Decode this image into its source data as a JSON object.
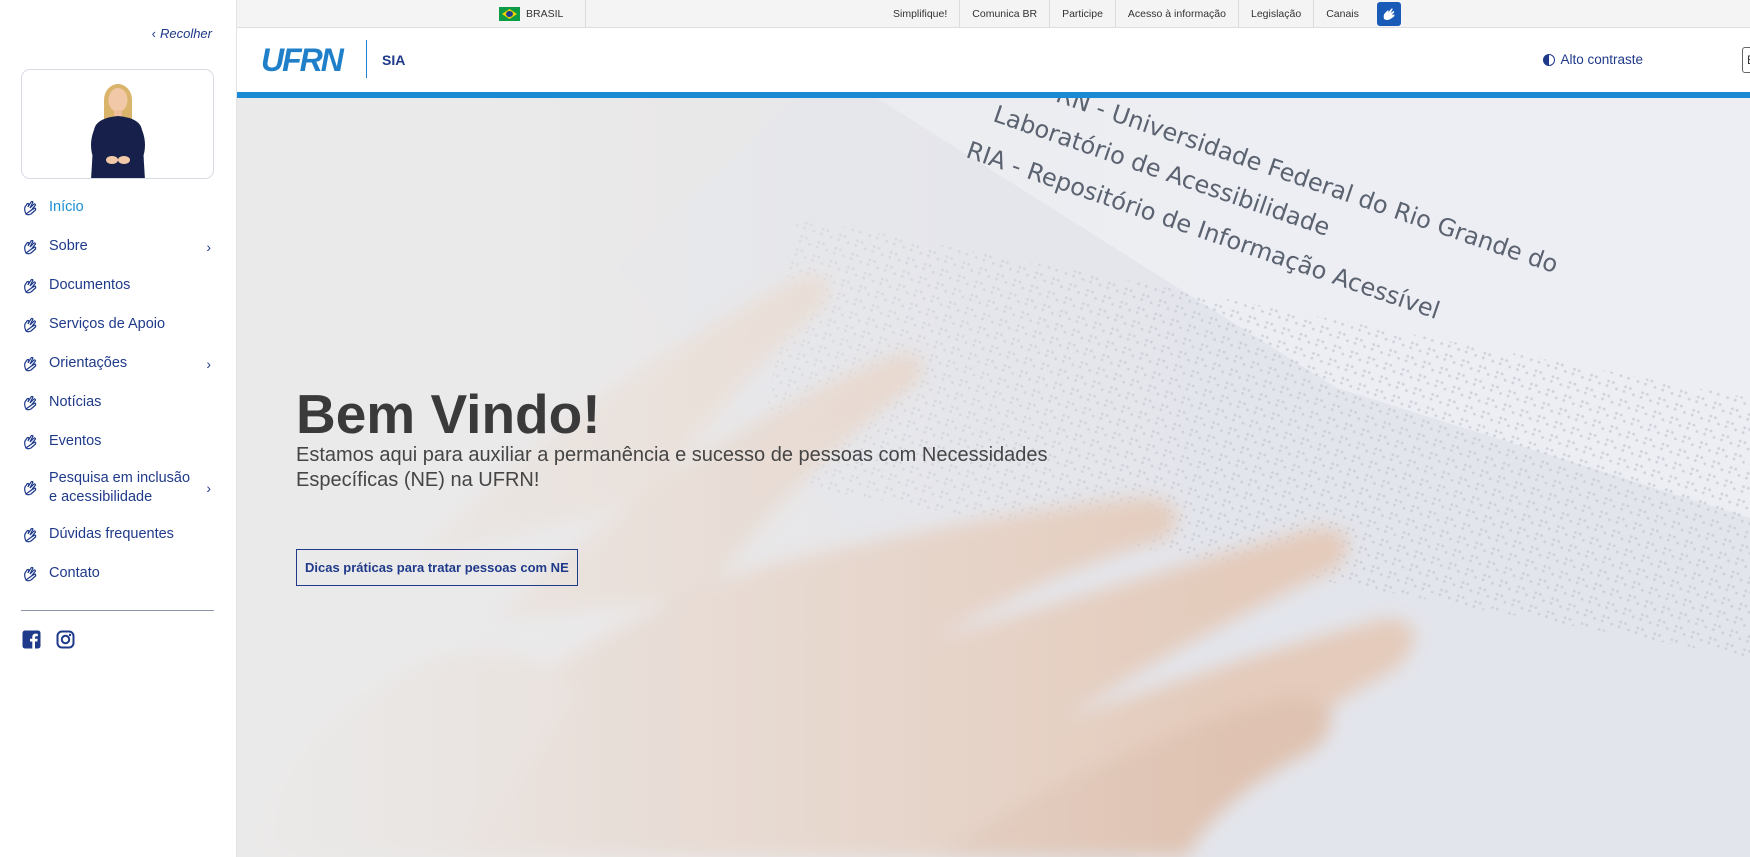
{
  "sidebar": {
    "collapse_label": "Recolher",
    "items": [
      {
        "label": "Início",
        "has_submenu": false,
        "active": true
      },
      {
        "label": "Sobre",
        "has_submenu": true
      },
      {
        "label": "Documentos",
        "has_submenu": false
      },
      {
        "label": "Serviços de Apoio",
        "has_submenu": false
      },
      {
        "label": "Orientações",
        "has_submenu": true
      },
      {
        "label": "Notícias",
        "has_submenu": false
      },
      {
        "label": "Eventos",
        "has_submenu": false
      },
      {
        "label": "Pesquisa em inclusão e acessibilidade",
        "has_submenu": true
      },
      {
        "label": "Dúvidas frequentes",
        "has_submenu": false
      },
      {
        "label": "Contato",
        "has_submenu": false
      }
    ],
    "arrow_glyph": "›",
    "item_icon": "hand-sign-icon",
    "socials": [
      "facebook-icon",
      "instagram-icon"
    ]
  },
  "govbar": {
    "country": "BRASIL",
    "links": [
      "Simplifique!",
      "Comunica BR",
      "Participe",
      "Acesso à informação",
      "Legislação",
      "Canais"
    ],
    "accessibility_icon": "vlibras-icon"
  },
  "header": {
    "logo": "UFRN",
    "site_name": "SIA",
    "contrast_label": "Alto contraste",
    "cutoff_button": "E"
  },
  "hero": {
    "title": "Bem Vindo!",
    "subtitle": "Estamos aqui para auxiliar a permanência e sucesso de pessoas com Necessidades Específicas (NE) na UFRN!",
    "button_label": "Dicas práticas para tratar pessoas com NE",
    "paper_lines": [
      "UFRN  -  Universidade Federal do Rio Grande do",
      "Laboratório de Acessibilidade",
      "RIA  -  Repositório de Informação Acessível"
    ]
  },
  "colors": {
    "primary": "#1f3a8a",
    "accent": "#1a8ad4",
    "active_link": "#1a8fd6"
  }
}
